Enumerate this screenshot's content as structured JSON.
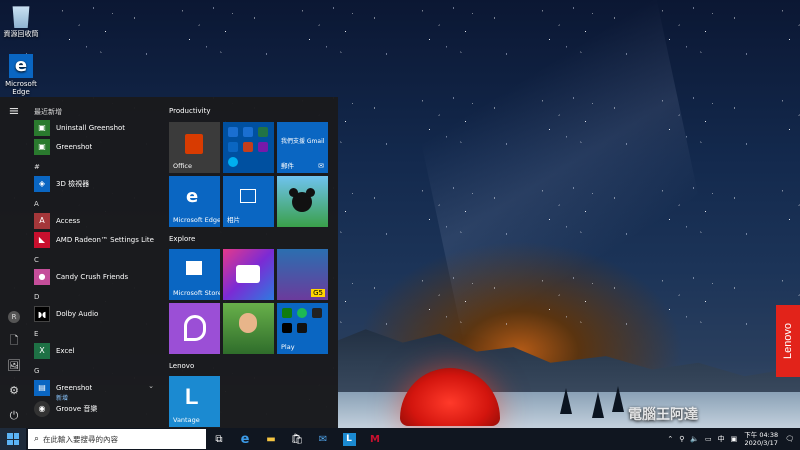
{
  "desktop": {
    "icons": [
      {
        "label": "資源回收筒",
        "icon": "recycle-bin-icon"
      },
      {
        "label": "Microsoft Edge",
        "icon": "edge-icon"
      }
    ]
  },
  "start_menu": {
    "rail": {
      "hamburger": "≡",
      "user_initial": "R",
      "document": "🗋",
      "pictures": "🖼",
      "settings": "⚙",
      "power": "⏻"
    },
    "app_list": {
      "recent_header": "最近新增",
      "apps": [
        {
          "label": "Uninstall Greenshot",
          "icon": "greenshot-icon",
          "color": "#2a7a2e"
        },
        {
          "label": "Greenshot",
          "icon": "greenshot-icon",
          "color": "#2a7a2e"
        },
        {
          "group": "#"
        },
        {
          "label": "3D 檢視器",
          "icon": "cube-icon",
          "color": "#0a66c2"
        },
        {
          "group": "A"
        },
        {
          "label": "Access",
          "icon": "access-icon",
          "color": "#a4373a"
        },
        {
          "label": "AMD Radeon™ Settings Lite",
          "icon": "amd-icon",
          "color": "#c8102e"
        },
        {
          "group": "C"
        },
        {
          "label": "Candy Crush Friends",
          "icon": "candy-icon",
          "color": "#c54e9a"
        },
        {
          "group": "D"
        },
        {
          "label": "Dolby Audio",
          "icon": "dolby-icon",
          "color": "#000000"
        },
        {
          "group": "E"
        },
        {
          "label": "Excel",
          "icon": "excel-icon",
          "color": "#1e7145"
        },
        {
          "group": "G"
        },
        {
          "label": "Greenshot",
          "sub": "新增",
          "icon": "folder-icon",
          "color": "#0a66c2"
        },
        {
          "label": "Groove 音樂",
          "icon": "groove-icon",
          "color": "#333333"
        }
      ]
    },
    "tiles": {
      "productivity_header": "Productivity",
      "explore_header": "Explore",
      "lenovo_header": "Lenovo",
      "office": "Office",
      "gmail": "我們支援 Gmail",
      "mail": "郵件",
      "edge": "Microsoft Edge",
      "photos": "相片",
      "store": "Microsoft Store",
      "play": "Play",
      "vantage": "Vantage"
    }
  },
  "lenovo_badge": "Lenovo",
  "taskbar": {
    "search_placeholder": "在此輸入要搜尋的內容",
    "time": "下午 04:38",
    "date": "2020/3/17",
    "ime": "中",
    "pinned": [
      "task-view-icon",
      "edge-icon",
      "file-explorer-icon",
      "store-icon",
      "mail-icon",
      "vantage-icon",
      "mcafee-icon"
    ]
  },
  "watermark": "電腦王阿達"
}
